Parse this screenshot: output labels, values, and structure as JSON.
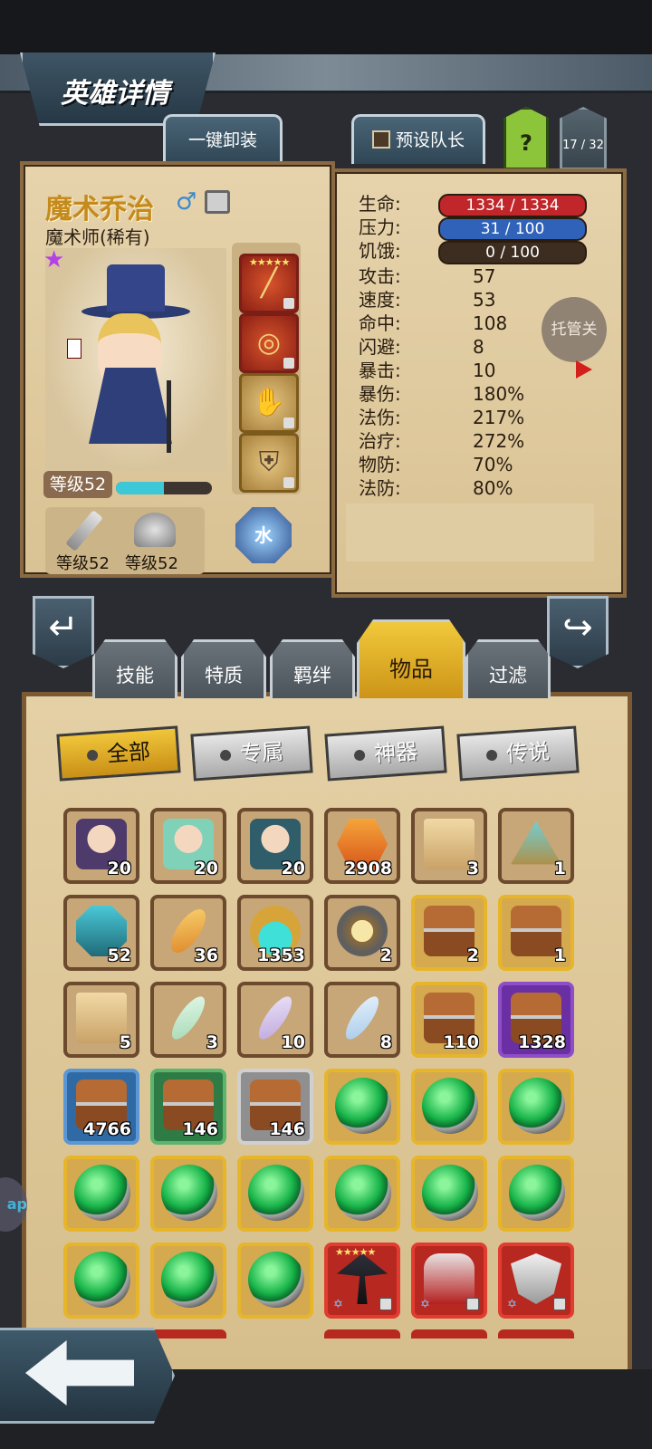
{
  "header": {
    "title": "英雄详情"
  },
  "top_buttons": {
    "unequip": "一键卸装",
    "preset_captain": "预设队长",
    "help": "?",
    "hero_count": "17 / 32"
  },
  "hero": {
    "name": "魔术乔治",
    "gender_icon": "male-icon",
    "class": "魔术师(稀有)",
    "level_label": "等级52",
    "level_progress": 0.5,
    "weapon_level": "等级52",
    "armor_level": "等级52",
    "element": "水"
  },
  "gear_slots": [
    {
      "icon": "wand-icon",
      "stars": "★★★★★"
    },
    {
      "icon": "ring-icon"
    },
    {
      "icon": "gloves-icon"
    },
    {
      "icon": "shield-icon"
    }
  ],
  "stats": {
    "hp": {
      "label": "生命:",
      "value": "1334 / 1334"
    },
    "stress": {
      "label": "压力:",
      "value": "31 / 100"
    },
    "hunger": {
      "label": "饥饿:",
      "value": "0 / 100"
    },
    "rows": [
      {
        "label": "攻击:",
        "value": "57"
      },
      {
        "label": "速度:",
        "value": "53"
      },
      {
        "label": "命中:",
        "value": "108"
      },
      {
        "label": "闪避:",
        "value": "8"
      },
      {
        "label": "暴击:",
        "value": "10"
      },
      {
        "label": "暴伤:",
        "value": "180%"
      },
      {
        "label": "法伤:",
        "value": "217%"
      },
      {
        "label": "治疗:",
        "value": "272%"
      },
      {
        "label": "物防:",
        "value": "70%"
      },
      {
        "label": "法防:",
        "value": "80%"
      }
    ],
    "auto_button": "托管关"
  },
  "tabs": [
    "技能",
    "特质",
    "羁绊",
    "物品",
    "过滤"
  ],
  "active_tab": "物品",
  "filters": [
    "全部",
    "专属",
    "神器",
    "传说"
  ],
  "inventory": [
    {
      "count": "20"
    },
    {
      "count": "20"
    },
    {
      "count": "20"
    },
    {
      "count": "2908"
    },
    {
      "count": "3"
    },
    {
      "count": "1"
    },
    {
      "count": "52"
    },
    {
      "count": "36"
    },
    {
      "count": "1353"
    },
    {
      "count": "2"
    },
    {
      "count": "2"
    },
    {
      "count": "1"
    },
    {
      "count": "5"
    },
    {
      "count": "3"
    },
    {
      "count": "10"
    },
    {
      "count": "8"
    },
    {
      "count": "110"
    },
    {
      "count": "1328"
    },
    {
      "count": "4766"
    },
    {
      "count": "146"
    },
    {
      "count": "146"
    },
    {
      "count": ""
    },
    {
      "count": ""
    },
    {
      "count": ""
    },
    {
      "count": ""
    },
    {
      "count": ""
    },
    {
      "count": ""
    },
    {
      "count": ""
    },
    {
      "count": ""
    },
    {
      "count": ""
    },
    {
      "count": ""
    },
    {
      "count": ""
    },
    {
      "count": ""
    },
    {
      "count": "",
      "stars": "★★★★★"
    },
    {
      "count": ""
    },
    {
      "count": ""
    }
  ],
  "side_bubble": "ap"
}
